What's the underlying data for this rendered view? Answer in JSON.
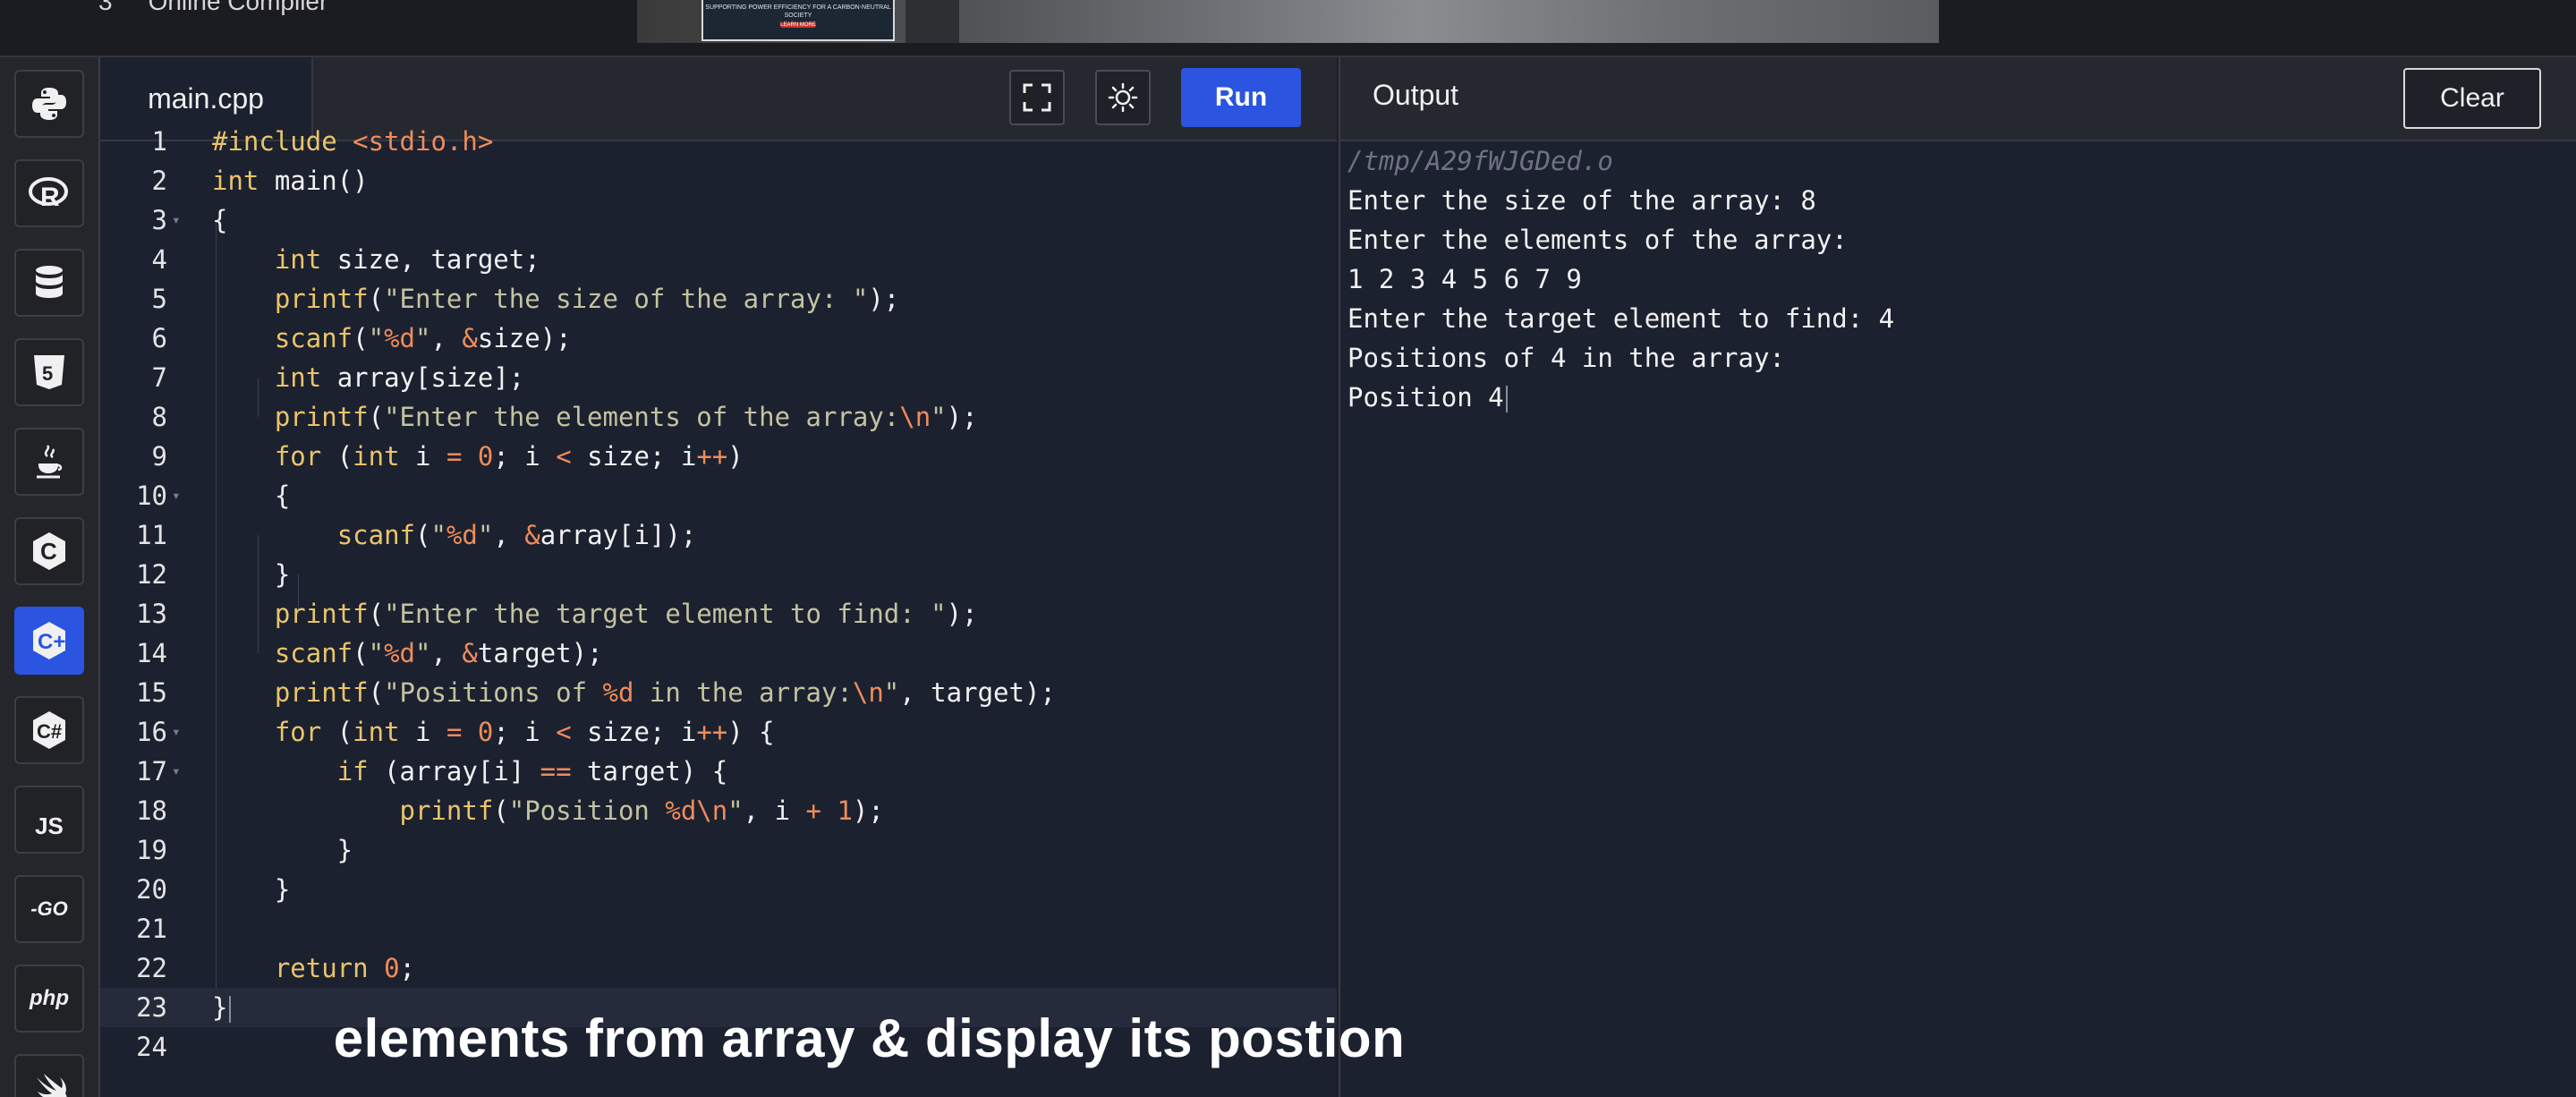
{
  "topbar": {
    "site_number": "3",
    "site_name": "Online Compiler",
    "ad_text": "SUPPORTING POWER EFFICIENCY FOR A CARBON-NEUTRAL SOCIETY",
    "ad_cta": "LEARN MORE"
  },
  "sidebar": {
    "items": [
      {
        "icon": "python-icon",
        "label": ""
      },
      {
        "icon": "r-icon",
        "label": "R"
      },
      {
        "icon": "database-icon",
        "label": ""
      },
      {
        "icon": "html5-icon",
        "label": "5"
      },
      {
        "icon": "java-icon",
        "label": ""
      },
      {
        "icon": "c-icon",
        "label": "C"
      },
      {
        "icon": "cpp-icon",
        "label": "C+"
      },
      {
        "icon": "csharp-icon",
        "label": "C#"
      },
      {
        "icon": "js-icon",
        "label": "JS"
      },
      {
        "icon": "go-icon",
        "label": "-GO"
      },
      {
        "icon": "php-icon",
        "label": "php"
      },
      {
        "icon": "swift-icon",
        "label": ""
      }
    ],
    "active_index": 6
  },
  "editor": {
    "file_tab": "main.cpp",
    "run_label": "Run",
    "line_numbers": [
      "1",
      "2",
      "3",
      "4",
      "5",
      "6",
      "7",
      "8",
      "9",
      "10",
      "11",
      "12",
      "13",
      "14",
      "15",
      "16",
      "17",
      "18",
      "19",
      "20",
      "21",
      "22",
      "23",
      "24"
    ]
  },
  "output": {
    "title": "Output",
    "clear_label": "Clear",
    "path": "/tmp/A29fWJGDed.o",
    "lines": [
      "Enter the size of the array: 8",
      "Enter the elements of the array:",
      "1 2 3 4 5 6 7 9",
      "Enter the target element to find: 4",
      "Positions of 4 in the array:",
      "Position 4"
    ]
  },
  "caption": "elements from array & display its postion",
  "colors": {
    "accent": "#2b54e0",
    "background": "#1c2130",
    "keyword": "#e9c46a",
    "string": "#c3c3a0",
    "number": "#ef8c5a"
  }
}
